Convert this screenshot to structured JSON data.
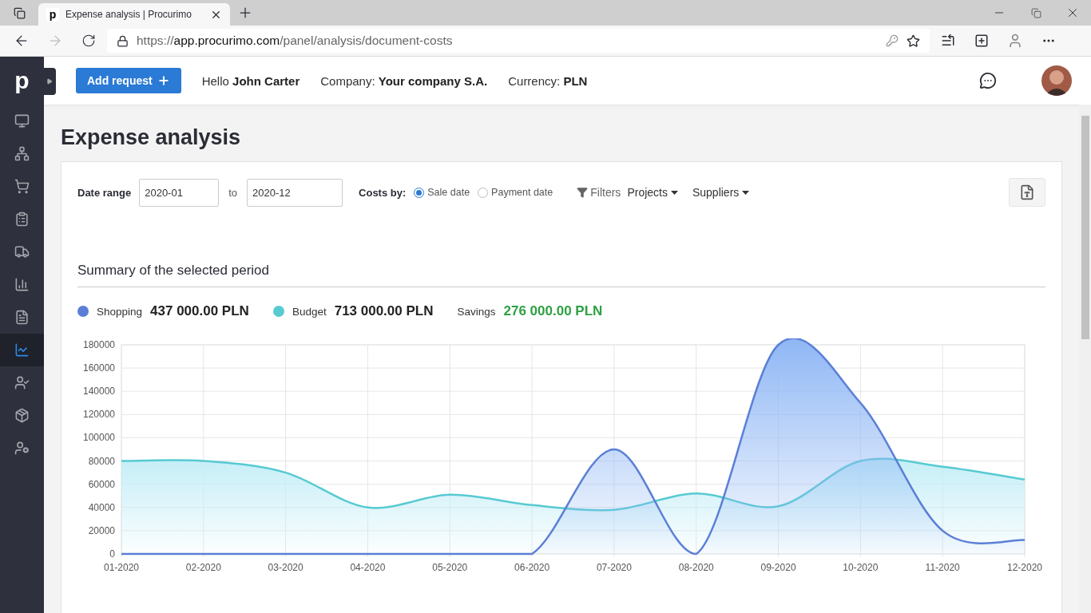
{
  "browser": {
    "favicon": "p",
    "tab_title": "Expense analysis | Procurimo",
    "url_scheme": "https://",
    "url_host": "app.procurimo.com",
    "url_path": "/panel/analysis/document-costs"
  },
  "header": {
    "logo": "p",
    "add_button": "Add request",
    "greeting_label": "Hello",
    "user_name": "John Carter",
    "company_label": "Company:",
    "company": "Your company S.A.",
    "currency_label": "Currency:",
    "currency": "PLN"
  },
  "sidebar": {
    "items": [
      {
        "kind": "monitor",
        "selected": false
      },
      {
        "kind": "network",
        "selected": false
      },
      {
        "kind": "cart",
        "selected": false
      },
      {
        "kind": "clipboard",
        "selected": false
      },
      {
        "kind": "truck",
        "selected": false
      },
      {
        "kind": "bars",
        "selected": false
      },
      {
        "kind": "file",
        "selected": false
      },
      {
        "kind": "trend",
        "selected": true
      },
      {
        "kind": "user-check",
        "selected": false
      },
      {
        "kind": "pallet",
        "selected": false
      },
      {
        "kind": "user-cog",
        "selected": false
      }
    ]
  },
  "page_title": "Expense analysis",
  "filters": {
    "date_range_label": "Date range",
    "date_from": "2020-01",
    "to_label": "to",
    "date_to": "2020-12",
    "costs_by_label": "Costs by:",
    "costs_by": [
      {
        "label": "Sale date",
        "selected": true
      },
      {
        "label": "Payment date",
        "selected": false
      }
    ],
    "filters_label": "Filters",
    "dropdowns": [
      "Projects",
      "Suppliers"
    ]
  },
  "summary": {
    "title": "Summary of the selected period",
    "totals": [
      {
        "label": "Shopping",
        "value": "437 000.00 PLN",
        "color": "#5b7fd6"
      },
      {
        "label": "Budget",
        "value": "713 000.00 PLN",
        "color": "#57cad2"
      },
      {
        "label": "Savings",
        "value": "276 000.00 PLN"
      }
    ],
    "chart_data": {
      "type": "area",
      "categories": [
        "01-2020",
        "02-2020",
        "03-2020",
        "04-2020",
        "05-2020",
        "06-2020",
        "07-2020",
        "08-2020",
        "09-2020",
        "10-2020",
        "11-2020",
        "12-2020"
      ],
      "ylim": [
        0,
        180000
      ],
      "grid": true,
      "yticks": [
        0,
        20000,
        40000,
        60000,
        80000,
        100000,
        120000,
        140000,
        160000,
        180000
      ],
      "series": [
        {
          "color": "#5b7fd6",
          "values": [
            0,
            0,
            0,
            0,
            0,
            0,
            90000,
            0,
            180000,
            130000,
            20000,
            12000
          ]
        },
        {
          "color": "#57cad2",
          "values": [
            80000,
            80000,
            70000,
            40000,
            51000,
            42000,
            38000,
            52000,
            41000,
            80000,
            75000,
            64000
          ]
        }
      ]
    }
  }
}
